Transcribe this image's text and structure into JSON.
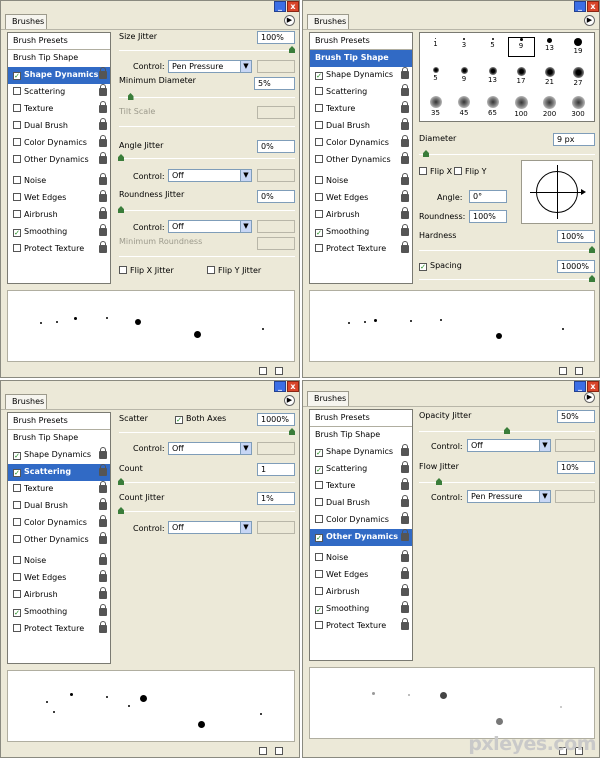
{
  "title_tab": "Brushes",
  "menu_glyph": "▶",
  "window_buttons": {
    "minimize": "_",
    "close": "x"
  },
  "list": {
    "presets": "Brush Presets",
    "tip_shape": "Brush Tip Shape",
    "items": {
      "shape": "Shape Dynamics",
      "scatter": "Scattering",
      "texture": "Texture",
      "dual": "Dual Brush",
      "color": "Color Dynamics",
      "other": "Other Dynamics",
      "noise": "Noise",
      "wet": "Wet Edges",
      "air": "Airbrush",
      "smooth": "Smoothing",
      "protect": "Protect Texture"
    }
  },
  "check_glyph": "✓",
  "p1": {
    "size_jitter_label": "Size Jitter",
    "size_jitter": "100%",
    "size_jitter_level": 1.0,
    "control_label": "Control:",
    "size_control": "Pen Pressure",
    "min_diameter_label": "Minimum Diameter",
    "min_diameter": "5%",
    "min_diameter_level": 0.05,
    "tilt_scale_label": "Tilt Scale",
    "angle_jitter_label": "Angle Jitter",
    "angle_jitter": "0%",
    "angle_control": "Off",
    "roundness_jitter_label": "Roundness Jitter",
    "roundness_jitter": "0%",
    "roundness_control": "Off",
    "min_roundness_label": "Minimum Roundness",
    "flip_x": "Flip X Jitter",
    "flip_y": "Flip Y Jitter"
  },
  "p2": {
    "tip_sizes": [
      "1",
      "3",
      "5",
      "9",
      "13",
      "19",
      "5",
      "9",
      "13",
      "17",
      "21",
      "27",
      "35",
      "45",
      "65",
      "100",
      "200",
      "300"
    ],
    "selected_tip": "9",
    "diameter_label": "Diameter",
    "diameter": "9 px",
    "flip_x": "Flip X",
    "flip_y": "Flip Y",
    "angle_label": "Angle:",
    "angle": "0°",
    "roundness_label": "Roundness:",
    "roundness": "100%",
    "hardness_label": "Hardness",
    "hardness": "100%",
    "hardness_level": 1.0,
    "spacing_label": "Spacing",
    "spacing": "1000%",
    "spacing_level": 1.0
  },
  "p3": {
    "scatter_label": "Scatter",
    "both_axes": "Both Axes",
    "scatter": "1000%",
    "scatter_level": 1.0,
    "control_label": "Control:",
    "scatter_control": "Off",
    "count_label": "Count",
    "count": "1",
    "count_jitter_label": "Count Jitter",
    "count_jitter": "1%",
    "count_control": "Off"
  },
  "p4": {
    "opacity_jitter_label": "Opacity Jitter",
    "opacity_jitter": "50%",
    "opacity_jitter_level": 0.5,
    "control_label": "Control:",
    "opacity_control": "Off",
    "flow_jitter_label": "Flow Jitter",
    "flow_jitter": "10%",
    "flow_jitter_level": 0.1,
    "flow_control": "Pen Pressure"
  },
  "watermark": "pxleyes.com"
}
